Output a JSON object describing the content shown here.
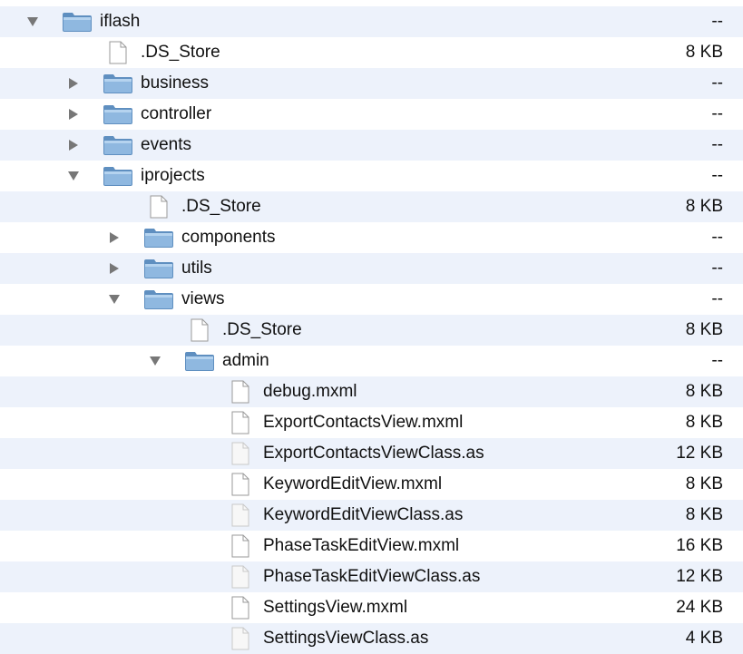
{
  "tree": {
    "rows": [
      {
        "name": "iflash",
        "size": "--",
        "type": "folder",
        "depth": 0,
        "expanded": true
      },
      {
        "name": ".DS_Store",
        "size": "8 KB",
        "type": "file",
        "depth": 1
      },
      {
        "name": "business",
        "size": "--",
        "type": "folder",
        "depth": 1,
        "expanded": false
      },
      {
        "name": "controller",
        "size": "--",
        "type": "folder",
        "depth": 1,
        "expanded": false
      },
      {
        "name": "events",
        "size": "--",
        "type": "folder",
        "depth": 1,
        "expanded": false
      },
      {
        "name": "iprojects",
        "size": "--",
        "type": "folder",
        "depth": 1,
        "expanded": true
      },
      {
        "name": ".DS_Store",
        "size": "8 KB",
        "type": "file",
        "depth": 2
      },
      {
        "name": "components",
        "size": "--",
        "type": "folder",
        "depth": 2,
        "expanded": false
      },
      {
        "name": "utils",
        "size": "--",
        "type": "folder",
        "depth": 2,
        "expanded": false
      },
      {
        "name": "views",
        "size": "--",
        "type": "folder",
        "depth": 2,
        "expanded": true
      },
      {
        "name": ".DS_Store",
        "size": "8 KB",
        "type": "file",
        "depth": 3
      },
      {
        "name": "admin",
        "size": "--",
        "type": "folder",
        "depth": 3,
        "expanded": true
      },
      {
        "name": "debug.mxml",
        "size": "8 KB",
        "type": "file",
        "depth": 4
      },
      {
        "name": "ExportContactsView.mxml",
        "size": "8 KB",
        "type": "file",
        "depth": 4
      },
      {
        "name": "ExportContactsViewClass.as",
        "size": "12 KB",
        "type": "file-faded",
        "depth": 4
      },
      {
        "name": "KeywordEditView.mxml",
        "size": "8 KB",
        "type": "file",
        "depth": 4
      },
      {
        "name": "KeywordEditViewClass.as",
        "size": "8 KB",
        "type": "file-faded",
        "depth": 4
      },
      {
        "name": "PhaseTaskEditView.mxml",
        "size": "16 KB",
        "type": "file",
        "depth": 4
      },
      {
        "name": "PhaseTaskEditViewClass.as",
        "size": "12 KB",
        "type": "file-faded",
        "depth": 4
      },
      {
        "name": "SettingsView.mxml",
        "size": "24 KB",
        "type": "file",
        "depth": 4
      },
      {
        "name": "SettingsViewClass.as",
        "size": "4 KB",
        "type": "file-faded",
        "depth": 4
      }
    ]
  },
  "colors": {
    "stripe": "#edf2fb",
    "folder": "#8fb8e0",
    "disclosure": "#777777"
  }
}
